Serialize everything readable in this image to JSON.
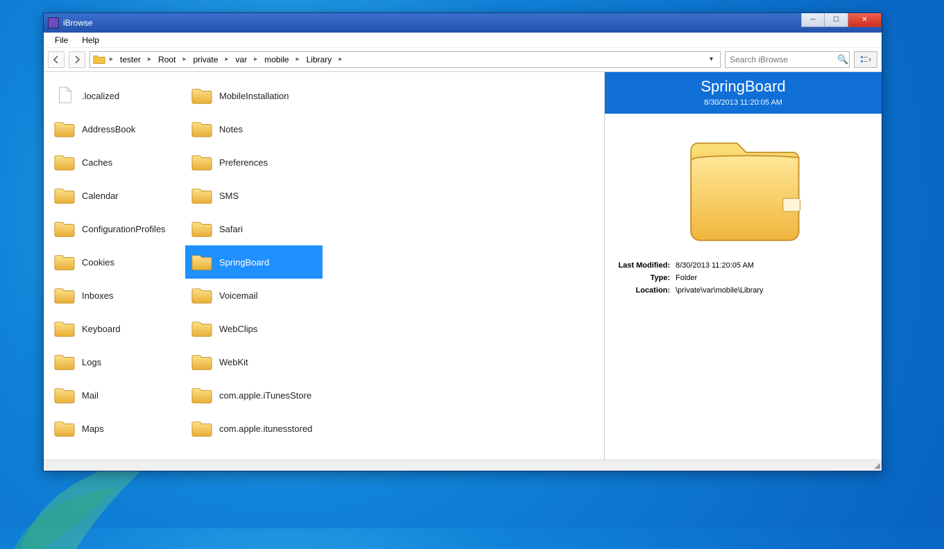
{
  "window": {
    "title": "iBrowse"
  },
  "menu": {
    "file": "File",
    "help": "Help"
  },
  "breadcrumb": [
    "tester",
    "Root",
    "private",
    "var",
    "mobile",
    "Library"
  ],
  "search": {
    "placeholder": "Search iBrowse"
  },
  "items": [
    {
      "name": ".localized",
      "type": "file"
    },
    {
      "name": "AddressBook",
      "type": "folder"
    },
    {
      "name": "Caches",
      "type": "folder"
    },
    {
      "name": "Calendar",
      "type": "folder"
    },
    {
      "name": "ConfigurationProfiles",
      "type": "folder"
    },
    {
      "name": "Cookies",
      "type": "folder"
    },
    {
      "name": "Inboxes",
      "type": "folder"
    },
    {
      "name": "Keyboard",
      "type": "folder"
    },
    {
      "name": "Logs",
      "type": "folder"
    },
    {
      "name": "Mail",
      "type": "folder"
    },
    {
      "name": "Maps",
      "type": "folder"
    },
    {
      "name": "MobileInstallation",
      "type": "folder"
    },
    {
      "name": "Notes",
      "type": "folder"
    },
    {
      "name": "Preferences",
      "type": "folder"
    },
    {
      "name": "SMS",
      "type": "folder"
    },
    {
      "name": "Safari",
      "type": "folder"
    },
    {
      "name": "SpringBoard",
      "type": "folder",
      "selected": true
    },
    {
      "name": "Voicemail",
      "type": "folder"
    },
    {
      "name": "WebClips",
      "type": "folder"
    },
    {
      "name": "WebKit",
      "type": "folder"
    },
    {
      "name": "com.apple.iTunesStore",
      "type": "folder"
    },
    {
      "name": "com.apple.itunesstored",
      "type": "folder"
    }
  ],
  "details": {
    "title": "SpringBoard",
    "subtitle": "8/30/2013 11:20:05 AM",
    "labels": {
      "modified": "Last Modified:",
      "type": "Type:",
      "location": "Location:"
    },
    "modified": "8/30/2013 11:20:05 AM",
    "type": "Folder",
    "location": "\\private\\var\\mobile\\Library"
  }
}
